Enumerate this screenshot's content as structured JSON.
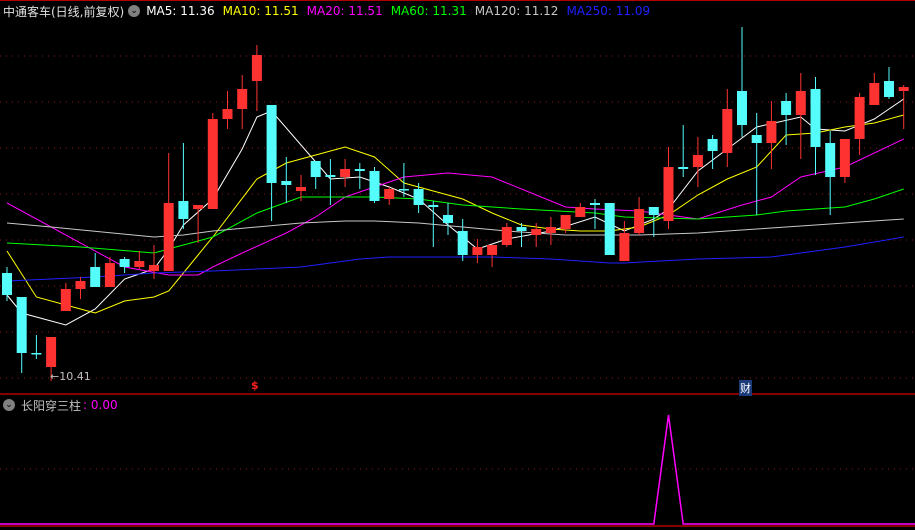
{
  "header": {
    "title": "中通客车(日线,前复权)",
    "ma_labels": [
      {
        "text": "MA5: 11.36",
        "color": "#ffffff"
      },
      {
        "text": "MA10: 11.51",
        "color": "#ffff00"
      },
      {
        "text": "MA20: 11.51",
        "color": "#ff00ff"
      },
      {
        "text": "MA60: 11.31",
        "color": "#00ff00"
      },
      {
        "text": "MA120: 11.12",
        "color": "#c8c8c8"
      },
      {
        "text": "MA250: 11.09",
        "color": "#2020ff"
      }
    ]
  },
  "indicator": {
    "name": "长阳穿三柱",
    "value": ": 0.00",
    "color": "#ff00ff"
  },
  "markers": {
    "low_label": "←10.41",
    "s_label": "$",
    "cai_label": "财"
  },
  "colors": {
    "up": "#ff3232",
    "down": "#54fcfc",
    "grid": "#8b1a1a",
    "frame": "#b00000"
  },
  "chart_data": {
    "type": "candlestick",
    "ohlc": [
      [
        10.92,
        10.95,
        10.78,
        10.81
      ],
      [
        10.8,
        10.8,
        10.42,
        10.52
      ],
      [
        10.52,
        10.61,
        10.49,
        10.52
      ],
      [
        10.45,
        10.6,
        10.41,
        10.6
      ],
      [
        10.73,
        10.87,
        10.73,
        10.84
      ],
      [
        10.84,
        10.9,
        10.79,
        10.88
      ],
      [
        10.95,
        11.02,
        10.85,
        10.85
      ],
      [
        10.85,
        11.0,
        10.85,
        10.97
      ],
      [
        10.99,
        11.0,
        10.92,
        10.95
      ],
      [
        10.95,
        11.03,
        10.94,
        10.98
      ],
      [
        10.93,
        11.06,
        10.89,
        10.96
      ],
      [
        10.93,
        11.52,
        10.93,
        11.27
      ],
      [
        11.28,
        11.57,
        11.14,
        11.19
      ],
      [
        11.24,
        11.26,
        11.07,
        11.26
      ],
      [
        11.24,
        11.72,
        11.24,
        11.69
      ],
      [
        11.69,
        11.83,
        11.64,
        11.74
      ],
      [
        11.74,
        11.91,
        11.64,
        11.84
      ],
      [
        11.88,
        12.06,
        11.73,
        12.01
      ],
      [
        11.76,
        11.76,
        11.18,
        11.37
      ],
      [
        11.38,
        11.5,
        11.27,
        11.36
      ],
      [
        11.33,
        11.41,
        11.28,
        11.35
      ],
      [
        11.48,
        11.48,
        11.34,
        11.4
      ],
      [
        11.41,
        11.49,
        11.26,
        11.4
      ],
      [
        11.4,
        11.49,
        11.35,
        11.44
      ],
      [
        11.44,
        11.47,
        11.34,
        11.43
      ],
      [
        11.43,
        11.45,
        11.27,
        11.28
      ],
      [
        11.29,
        11.35,
        11.26,
        11.34
      ],
      [
        11.34,
        11.47,
        11.3,
        11.34
      ],
      [
        11.34,
        11.37,
        11.22,
        11.26
      ],
      [
        11.26,
        11.28,
        11.05,
        11.25
      ],
      [
        11.21,
        11.27,
        11.11,
        11.17
      ],
      [
        11.13,
        11.19,
        10.98,
        11.01
      ],
      [
        11.01,
        11.09,
        10.97,
        11.05
      ],
      [
        11.01,
        11.06,
        10.95,
        11.06
      ],
      [
        11.06,
        11.17,
        11.05,
        11.15
      ],
      [
        11.15,
        11.17,
        11.05,
        11.13
      ],
      [
        11.11,
        11.17,
        11.05,
        11.14
      ],
      [
        11.12,
        11.2,
        11.06,
        11.15
      ],
      [
        11.14,
        11.21,
        11.12,
        11.21
      ],
      [
        11.2,
        11.27,
        11.2,
        11.25
      ],
      [
        11.27,
        11.29,
        11.14,
        11.26
      ],
      [
        11.27,
        11.27,
        11.01,
        11.01
      ],
      [
        10.98,
        11.18,
        10.98,
        11.12
      ],
      [
        11.12,
        11.3,
        11.11,
        11.24
      ],
      [
        11.25,
        11.25,
        11.1,
        11.21
      ],
      [
        11.18,
        11.55,
        11.14,
        11.45
      ],
      [
        11.45,
        11.66,
        11.4,
        11.44
      ],
      [
        11.45,
        11.6,
        11.35,
        11.51
      ],
      [
        11.59,
        11.61,
        11.44,
        11.53
      ],
      [
        11.52,
        11.84,
        11.45,
        11.74
      ],
      [
        11.83,
        12.15,
        11.6,
        11.66
      ],
      [
        11.61,
        11.72,
        11.21,
        11.57
      ],
      [
        11.57,
        11.78,
        11.44,
        11.68
      ],
      [
        11.78,
        11.82,
        11.56,
        11.71
      ],
      [
        11.71,
        11.92,
        11.49,
        11.83
      ],
      [
        11.84,
        11.9,
        11.41,
        11.55
      ],
      [
        11.57,
        11.63,
        11.21,
        11.4
      ],
      [
        11.4,
        11.59,
        11.37,
        11.59
      ],
      [
        11.59,
        11.82,
        11.51,
        11.8
      ],
      [
        11.76,
        11.92,
        11.76,
        11.87
      ],
      [
        11.88,
        11.95,
        11.79,
        11.8
      ],
      [
        11.83,
        11.86,
        11.64,
        11.85
      ]
    ],
    "ma_series": [
      {
        "name": "MA5",
        "color": "#ffffff",
        "points": [
          [
            1,
            10.81
          ],
          [
            2,
            10.72
          ],
          [
            5,
            10.66
          ],
          [
            7,
            10.74
          ],
          [
            9,
            10.89
          ],
          [
            11,
            10.94
          ],
          [
            12,
            11.04
          ],
          [
            13,
            11.16
          ],
          [
            15,
            11.29
          ],
          [
            17,
            11.54
          ],
          [
            18,
            11.7
          ],
          [
            19,
            11.73
          ],
          [
            21,
            11.56
          ],
          [
            23,
            11.39
          ],
          [
            25,
            11.4
          ],
          [
            27,
            11.35
          ],
          [
            29,
            11.29
          ],
          [
            31,
            11.16
          ],
          [
            33,
            11.04
          ],
          [
            35,
            11.09
          ],
          [
            38,
            11.13
          ],
          [
            41,
            11.2
          ],
          [
            43,
            11.13
          ],
          [
            45,
            11.19
          ],
          [
            46,
            11.24
          ],
          [
            48,
            11.43
          ],
          [
            50,
            11.54
          ],
          [
            52,
            11.65
          ],
          [
            55,
            11.7
          ],
          [
            56,
            11.64
          ],
          [
            58,
            11.63
          ],
          [
            60,
            11.69
          ],
          [
            62,
            11.79
          ]
        ]
      },
      {
        "name": "MA10",
        "color": "#ffff00",
        "points": [
          [
            1,
            11.03
          ],
          [
            3,
            10.8
          ],
          [
            5,
            10.76
          ],
          [
            7,
            10.72
          ],
          [
            9,
            10.78
          ],
          [
            11,
            10.8
          ],
          [
            12,
            10.83
          ],
          [
            14,
            11.01
          ],
          [
            15,
            11.1
          ],
          [
            18,
            11.39
          ],
          [
            20,
            11.47
          ],
          [
            22,
            11.51
          ],
          [
            24,
            11.55
          ],
          [
            26,
            11.5
          ],
          [
            28,
            11.37
          ],
          [
            30,
            11.33
          ],
          [
            32,
            11.29
          ],
          [
            34,
            11.22
          ],
          [
            36,
            11.16
          ],
          [
            38,
            11.14
          ],
          [
            40,
            11.13
          ],
          [
            42,
            11.13
          ],
          [
            44,
            11.15
          ],
          [
            46,
            11.21
          ],
          [
            48,
            11.31
          ],
          [
            50,
            11.39
          ],
          [
            52,
            11.45
          ],
          [
            54,
            11.61
          ],
          [
            56,
            11.62
          ],
          [
            58,
            11.65
          ],
          [
            60,
            11.67
          ],
          [
            62,
            11.71
          ]
        ]
      },
      {
        "name": "MA20",
        "color": "#ff00ff",
        "points": [
          [
            1,
            11.27
          ],
          [
            9,
            10.95
          ],
          [
            12,
            10.91
          ],
          [
            14,
            10.91
          ],
          [
            15,
            10.95
          ],
          [
            17,
            11.02
          ],
          [
            20,
            11.12
          ],
          [
            22,
            11.2
          ],
          [
            24,
            11.3
          ],
          [
            26,
            11.35
          ],
          [
            28,
            11.4
          ],
          [
            31,
            11.42
          ],
          [
            34,
            11.4
          ],
          [
            37,
            11.31
          ],
          [
            39,
            11.25
          ],
          [
            41,
            11.24
          ],
          [
            44,
            11.23
          ],
          [
            48,
            11.19
          ],
          [
            51,
            11.26
          ],
          [
            53,
            11.3
          ],
          [
            55,
            11.4
          ],
          [
            58,
            11.45
          ],
          [
            62,
            11.59
          ]
        ]
      },
      {
        "name": "MA60",
        "color": "#00ff00",
        "points": [
          [
            1,
            11.07
          ],
          [
            6,
            11.05
          ],
          [
            11,
            11.02
          ],
          [
            15,
            11.1
          ],
          [
            18,
            11.22
          ],
          [
            21,
            11.3
          ],
          [
            23,
            11.3
          ],
          [
            26,
            11.3
          ],
          [
            29,
            11.29
          ],
          [
            32,
            11.26
          ],
          [
            36,
            11.24
          ],
          [
            41,
            11.22
          ],
          [
            43,
            11.2
          ],
          [
            48,
            11.19
          ],
          [
            52,
            11.21
          ],
          [
            54,
            11.23
          ],
          [
            58,
            11.25
          ],
          [
            60,
            11.29
          ],
          [
            62,
            11.34
          ]
        ]
      },
      {
        "name": "MA120",
        "color": "#c8c8c8",
        "points": [
          [
            1,
            11.17
          ],
          [
            4,
            11.15
          ],
          [
            11,
            11.1
          ],
          [
            13,
            11.11
          ],
          [
            15,
            11.13
          ],
          [
            18,
            11.15
          ],
          [
            21,
            11.17
          ],
          [
            24,
            11.18
          ],
          [
            26,
            11.18
          ],
          [
            29,
            11.17
          ],
          [
            32,
            11.15
          ],
          [
            35,
            11.13
          ],
          [
            39,
            11.11
          ],
          [
            42,
            11.11
          ],
          [
            44,
            11.11
          ],
          [
            48,
            11.12
          ],
          [
            52,
            11.14
          ],
          [
            56,
            11.16
          ],
          [
            62,
            11.19
          ]
        ]
      },
      {
        "name": "MA250",
        "color": "#2020ff",
        "points": [
          [
            1,
            10.88
          ],
          [
            7,
            10.9
          ],
          [
            11,
            10.92
          ],
          [
            15,
            10.93
          ],
          [
            21,
            10.95
          ],
          [
            25,
            10.99
          ],
          [
            27,
            11.0
          ],
          [
            34,
            11.0
          ],
          [
            38,
            10.99
          ],
          [
            42,
            10.97
          ],
          [
            43,
            10.97
          ],
          [
            48,
            10.99
          ],
          [
            53,
            11.0
          ],
          [
            58,
            11.05
          ],
          [
            62,
            11.1
          ]
        ]
      }
    ],
    "indicator_values_nonzero": [
      [
        46,
        1
      ]
    ],
    "indicator_ylim": [
      0,
      1
    ],
    "low_point": {
      "index": 4,
      "value": 10.41
    },
    "grid": true
  }
}
